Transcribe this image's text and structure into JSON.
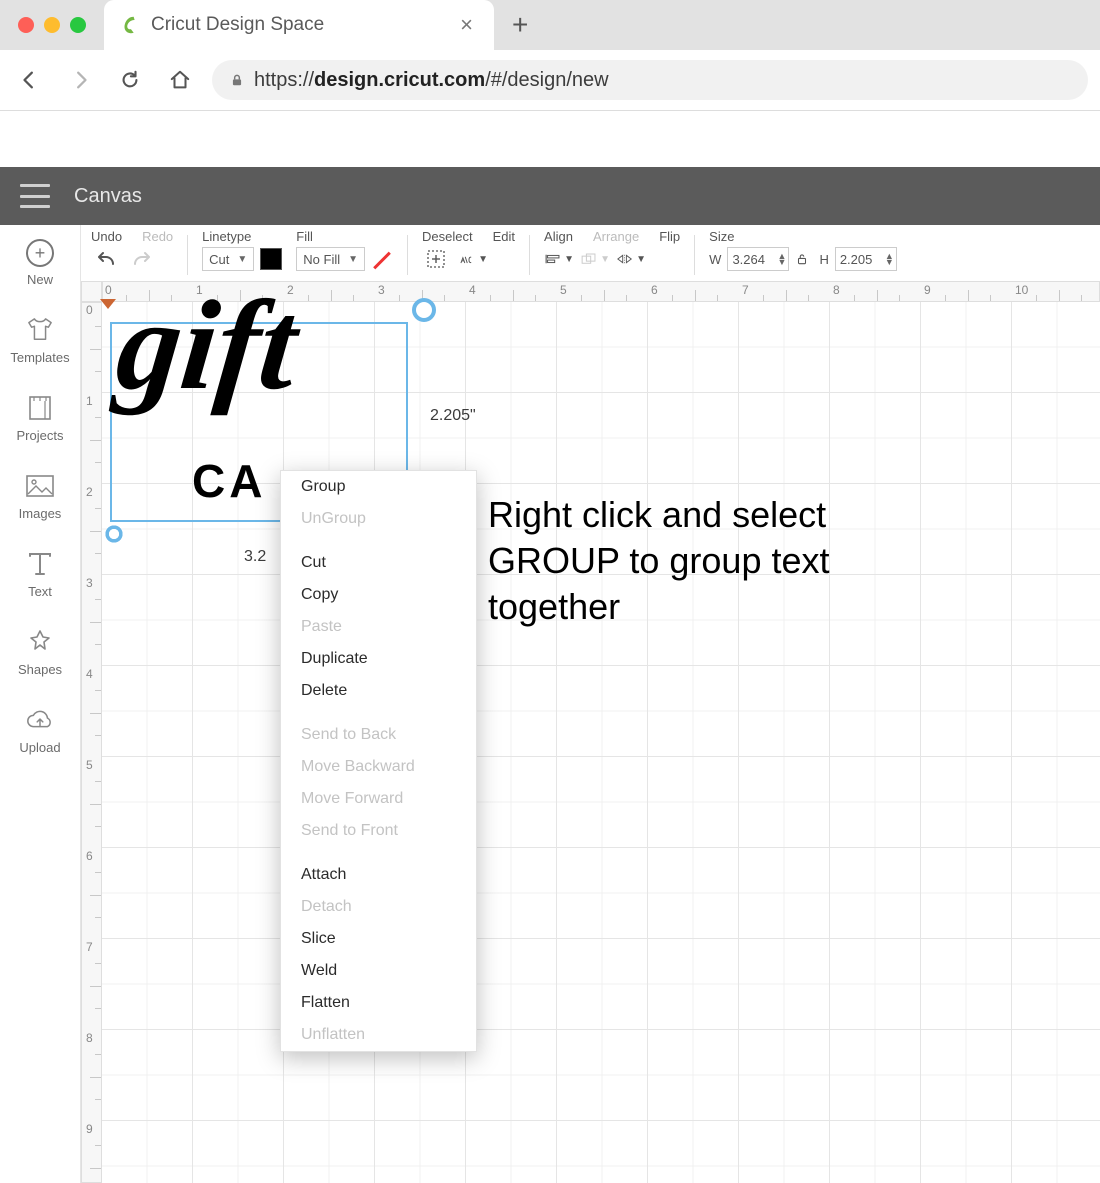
{
  "browser": {
    "tab_title": "Cricut Design Space",
    "url_prefix": "https://",
    "url_host": "design.cricut.com",
    "url_path": "/#/design/new"
  },
  "app": {
    "breadcrumb": "Canvas"
  },
  "sidebar": {
    "items": [
      {
        "label": "New",
        "icon": "plus-circle-icon"
      },
      {
        "label": "Templates",
        "icon": "shirt-icon"
      },
      {
        "label": "Projects",
        "icon": "notebook-icon"
      },
      {
        "label": "Images",
        "icon": "picture-icon"
      },
      {
        "label": "Text",
        "icon": "text-icon"
      },
      {
        "label": "Shapes",
        "icon": "shapes-icon"
      },
      {
        "label": "Upload",
        "icon": "cloud-upload-icon"
      }
    ]
  },
  "toolbar": {
    "undo": "Undo",
    "redo": "Redo",
    "linetype_label": "Linetype",
    "linetype_value": "Cut",
    "fill_label": "Fill",
    "fill_value": "No Fill",
    "deselect": "Deselect",
    "edit": "Edit",
    "align": "Align",
    "arrange": "Arrange",
    "flip": "Flip",
    "size": "Size",
    "w_label": "W",
    "w_value": "3.264",
    "h_label": "H",
    "h_value": "2.205"
  },
  "ruler": {
    "h_ticks": [
      "0",
      "1",
      "2",
      "3",
      "4",
      "5",
      "6",
      "7",
      "8",
      "9",
      "10"
    ],
    "v_ticks": [
      "0",
      "1",
      "2",
      "3",
      "4",
      "5",
      "6",
      "7",
      "8",
      "9"
    ]
  },
  "selection": {
    "dim_label": "2.205\"",
    "truncated_w": "3.2"
  },
  "artwork": {
    "line1": "gift",
    "line2": "CA"
  },
  "context_menu": {
    "items": [
      {
        "label": "Group",
        "enabled": true
      },
      {
        "label": "UnGroup",
        "enabled": false
      },
      {
        "sep": true
      },
      {
        "label": "Cut",
        "enabled": true
      },
      {
        "label": "Copy",
        "enabled": true
      },
      {
        "label": "Paste",
        "enabled": false
      },
      {
        "label": "Duplicate",
        "enabled": true
      },
      {
        "label": "Delete",
        "enabled": true
      },
      {
        "sep": true
      },
      {
        "label": "Send to Back",
        "enabled": false
      },
      {
        "label": "Move Backward",
        "enabled": false
      },
      {
        "label": "Move Forward",
        "enabled": false
      },
      {
        "label": "Send to Front",
        "enabled": false
      },
      {
        "sep": true
      },
      {
        "label": "Attach",
        "enabled": true
      },
      {
        "label": "Detach",
        "enabled": false
      },
      {
        "label": "Slice",
        "enabled": true
      },
      {
        "label": "Weld",
        "enabled": true
      },
      {
        "label": "Flatten",
        "enabled": true
      },
      {
        "label": "Unflatten",
        "enabled": false
      }
    ]
  },
  "annotation": {
    "text1": "Right click and select",
    "text2": "GROUP to group text",
    "text3": "together"
  }
}
